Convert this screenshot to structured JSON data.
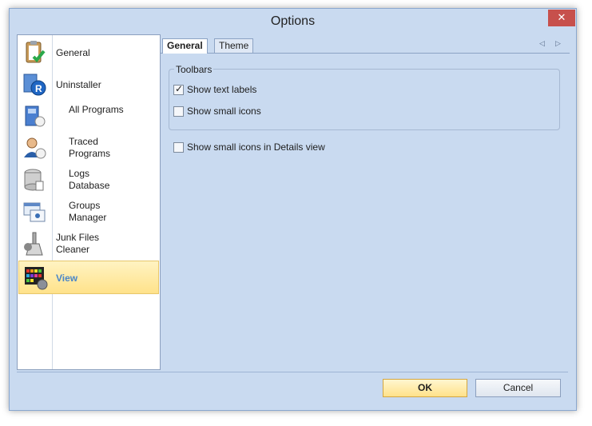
{
  "window": {
    "title": "Options"
  },
  "nav": {
    "items": [
      {
        "label": "General",
        "icon": "clipboard-check-icon"
      },
      {
        "label": "Uninstaller",
        "icon": "uninstaller-icon"
      },
      {
        "label": "All Programs",
        "icon": "programs-icon"
      },
      {
        "label": "Traced Programs",
        "icon": "user-trace-icon"
      },
      {
        "label": "Logs Database",
        "icon": "database-icon"
      },
      {
        "label": "Groups Manager",
        "icon": "groups-icon"
      },
      {
        "label": "Junk Files Cleaner",
        "icon": "broom-icon"
      },
      {
        "label": "View",
        "icon": "view-palette-icon",
        "selected": true
      }
    ]
  },
  "tabs": [
    {
      "label": "General",
      "active": true
    },
    {
      "label": "Theme",
      "active": false
    }
  ],
  "toolbars": {
    "title": "Toolbars",
    "show_text_labels": {
      "label": "Show text labels",
      "checked": true
    },
    "show_small_icons": {
      "label": "Show small icons",
      "checked": false
    }
  },
  "details": {
    "small_icons_details": {
      "label": "Show small icons in Details view",
      "checked": false
    }
  },
  "buttons": {
    "ok": "OK",
    "cancel": "Cancel"
  },
  "colors": {
    "window_bg": "#c9daf0",
    "accent": "#4a86c8",
    "selected_bg": "#ffe28a"
  }
}
